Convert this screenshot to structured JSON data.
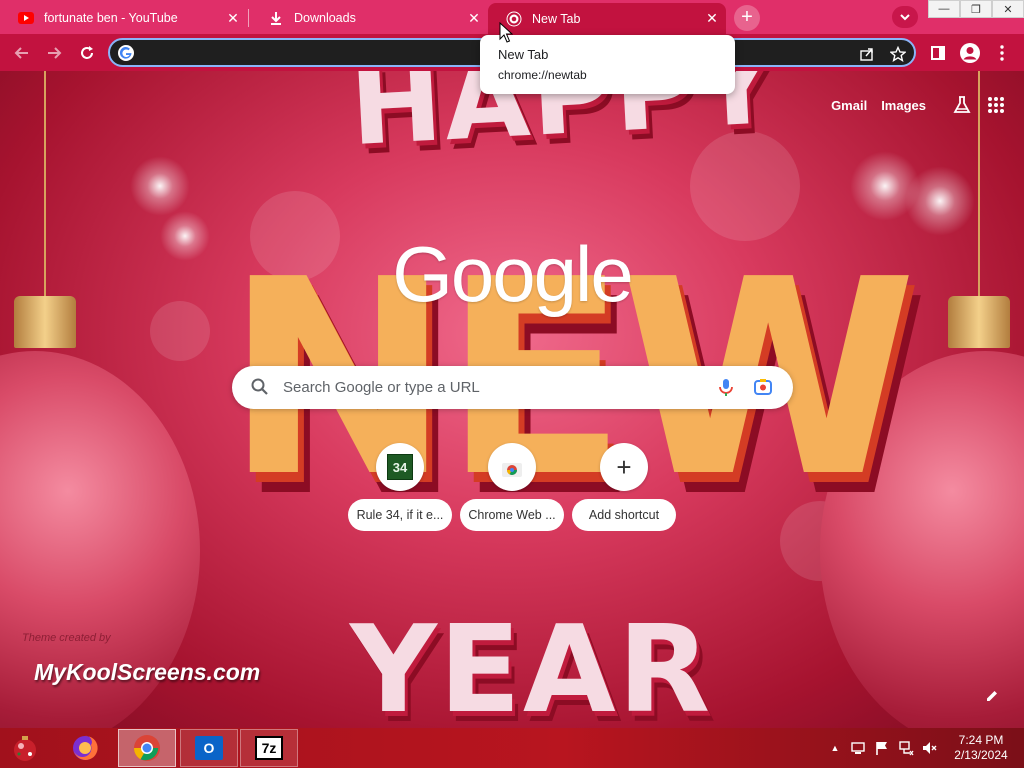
{
  "tabs": [
    {
      "title": "fortunate ben - YouTube",
      "favicon": "youtube-icon",
      "active": false
    },
    {
      "title": "Downloads",
      "favicon": "download-icon",
      "active": false
    },
    {
      "title": "New Tab",
      "favicon": "chrome-icon",
      "active": true
    }
  ],
  "tab_close_glyph": "✕",
  "new_tab_glyph": "+",
  "tooltip": {
    "title": "New Tab",
    "url": "chrome://newtab"
  },
  "omnibox": {
    "value": ""
  },
  "top_links": {
    "gmail": "Gmail",
    "images": "Images"
  },
  "search": {
    "placeholder": "Search Google or type a URL"
  },
  "google_logo": "Google",
  "shortcuts": [
    {
      "label": "Rule 34, if it e...",
      "icon_text": "34"
    },
    {
      "label": "Chrome Web ...",
      "icon_text": ""
    },
    {
      "label": "Add shortcut",
      "icon_text": "+"
    }
  ],
  "decorative_text": {
    "happy": "HAPPY",
    "new": "NEW",
    "year": "YEAR"
  },
  "theme_credit": {
    "small": "Theme created by",
    "big": "MyKoolScreens.com"
  },
  "window_controls": {
    "minimize": "—",
    "restore": "❐",
    "close": "✕"
  },
  "taskbar": {
    "apps": [
      {
        "name": "start-button"
      },
      {
        "name": "firefox"
      },
      {
        "name": "chrome"
      },
      {
        "name": "outlook",
        "text": "O"
      },
      {
        "name": "7zip",
        "text": "7z"
      }
    ],
    "tray_arrow": "▲"
  },
  "clock": {
    "time": "7:24 PM",
    "date": "2/13/2024"
  },
  "colors": {
    "tab_strip": "#e02f69",
    "toolbar": "#c2123f",
    "omnibox_bg": "#1f1f1f",
    "omnibox_focus": "#8ab4f8",
    "taskbar": "#a1111c"
  }
}
